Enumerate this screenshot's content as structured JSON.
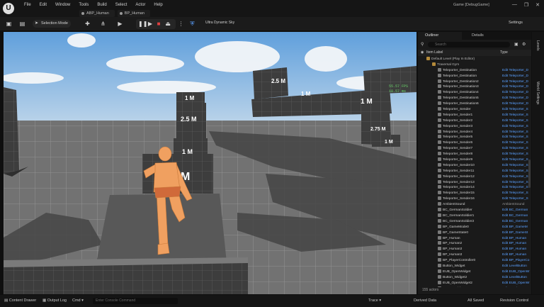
{
  "titlebar": {
    "menus": [
      "File",
      "Edit",
      "Window",
      "Tools",
      "Build",
      "Select",
      "Actor",
      "Help"
    ],
    "tabs": [
      "ABP_Human",
      "BP_Human"
    ],
    "window_title": "Game [DebugGame]",
    "buttons": [
      "—",
      "❐",
      "✕"
    ]
  },
  "toolbar": {
    "selection_mode": "Selection Mode",
    "sky_label": "Ultra Dynamic Sky",
    "settings_label": "Settings"
  },
  "viewport": {
    "fps": "55.57 FPS",
    "ms": "18.57 ms",
    "block_labels": [
      "1 M",
      "2.5 M",
      "1 M",
      "M",
      "2.5 M",
      "1 M",
      "1 M",
      "2.75 M",
      "1 M"
    ]
  },
  "outliner": {
    "tab_outliner": "Outliner",
    "tab_details": "Details",
    "search_placeholder": "Search",
    "col_label": "Item Label",
    "col_type": "Type",
    "rows": [
      {
        "name": "Default Level (Play In Editor)",
        "type": "",
        "grp": true
      },
      {
        "name": "Traversal Gym",
        "type": "",
        "grp": true
      },
      {
        "name": "Teleporter_Destination",
        "type": "Edit Teleporter_D"
      },
      {
        "name": "Teleporter_Destination",
        "type": "Edit Teleporter_D"
      },
      {
        "name": "Teleporter_Destination2",
        "type": "Edit Teleporter_D"
      },
      {
        "name": "Teleporter_Destination3",
        "type": "Edit Teleporter_D"
      },
      {
        "name": "Teleporter_Destination4",
        "type": "Edit Teleporter_D"
      },
      {
        "name": "Teleporter_Destination5",
        "type": "Edit Teleporter_D"
      },
      {
        "name": "Teleporter_Destination6",
        "type": "Edit Teleporter_D"
      },
      {
        "name": "Teleporter_Sender",
        "type": "Edit Teleporter_S"
      },
      {
        "name": "Teleporter_Sender1",
        "type": "Edit Teleporter_S"
      },
      {
        "name": "Teleporter_Sender2",
        "type": "Edit Teleporter_S"
      },
      {
        "name": "Teleporter_Sender3",
        "type": "Edit Teleporter_S"
      },
      {
        "name": "Teleporter_Sender4",
        "type": "Edit Teleporter_S"
      },
      {
        "name": "Teleporter_Sender5",
        "type": "Edit Teleporter_S"
      },
      {
        "name": "Teleporter_Sender6",
        "type": "Edit Teleporter_S"
      },
      {
        "name": "Teleporter_Sender7",
        "type": "Edit Teleporter_S"
      },
      {
        "name": "Teleporter_Sender8",
        "type": "Edit Teleporter_S"
      },
      {
        "name": "Teleporter_Sender9",
        "type": "Edit Teleporter_S"
      },
      {
        "name": "Teleporter_Sender10",
        "type": "Edit Teleporter_S"
      },
      {
        "name": "Teleporter_Sender11",
        "type": "Edit Teleporter_S"
      },
      {
        "name": "Teleporter_Sender12",
        "type": "Edit Teleporter_S"
      },
      {
        "name": "Teleporter_Sender13",
        "type": "Edit Teleporter_S"
      },
      {
        "name": "Teleporter_Sender14",
        "type": "Edit Teleporter_S"
      },
      {
        "name": "Teleporter_Sender15",
        "type": "Edit Teleporter_S"
      },
      {
        "name": "Teleporter_Sender16",
        "type": "Edit Teleporter_S"
      },
      {
        "name": "AmbientSound",
        "type": "AmbientSound",
        "plain": true
      },
      {
        "name": "BC_GermanSoldier",
        "type": "Edit BC_German"
      },
      {
        "name": "BC_GermanSoldier1",
        "type": "Edit BC_German"
      },
      {
        "name": "BC_GermanSoldier2",
        "type": "Edit BC_German"
      },
      {
        "name": "BP_GameMode0",
        "type": "Edit BP_GameM"
      },
      {
        "name": "BP_GameState0",
        "type": "Edit BP_GameSt"
      },
      {
        "name": "BP_Human",
        "type": "Edit BP_Human"
      },
      {
        "name": "BP_Human2",
        "type": "Edit BP_Human"
      },
      {
        "name": "BP_Human3",
        "type": "Edit BP_Human"
      },
      {
        "name": "BP_Human3",
        "type": "Edit BP_Human"
      },
      {
        "name": "BP_PlayerController0",
        "type": "Edit BP_PlayerCo"
      },
      {
        "name": "Button_Widget",
        "type": "Edit LevelButton"
      },
      {
        "name": "EUB_OpenWidget",
        "type": "Edit EUB_OpenW"
      },
      {
        "name": "Button_Widget2",
        "type": "Edit LevelButton"
      },
      {
        "name": "EUB_OpenWidget2",
        "type": "Edit EUB_OpenW"
      },
      {
        "name": "Button_Widget3",
        "type": "Edit LevelButton"
      },
      {
        "name": "EUB_OpenWidget3",
        "type": "Edit EUB_OpenW"
      }
    ],
    "actor_count": "155 actors"
  },
  "rail": {
    "levels": "Levels",
    "world_settings": "World Settings"
  },
  "statusbar": {
    "content_drawer": "Content Drawer",
    "output_log": "Output Log",
    "cmd": "Cmd",
    "cmd_placeholder": "Enter Console Command",
    "trace": "Trace",
    "derived_data": "Derived Data",
    "all_saved": "All Saved",
    "revision_control": "Revision Control"
  },
  "colors": {
    "accent": "#5aa0ff",
    "selection": "#163b5e",
    "fps": "#6bd46b"
  }
}
